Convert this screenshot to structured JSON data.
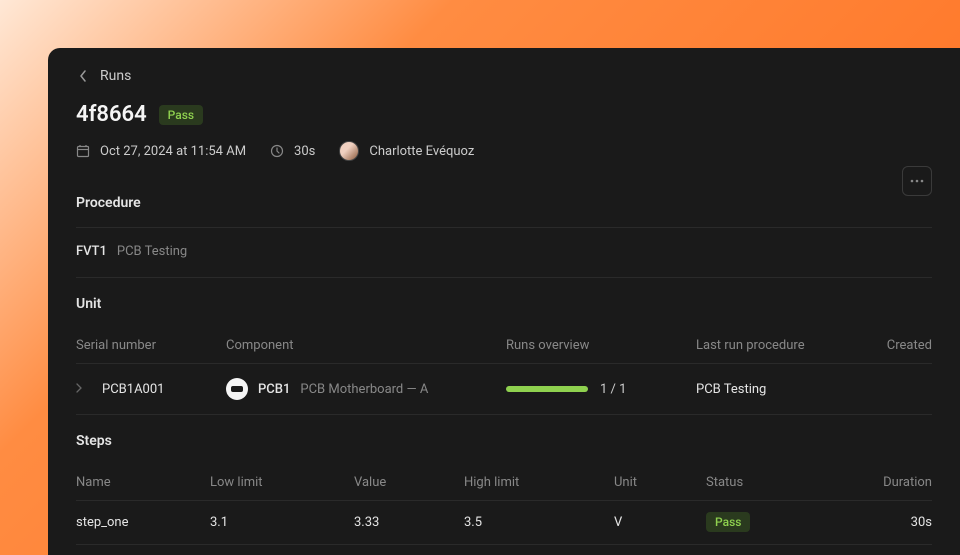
{
  "breadcrumb": {
    "label": "Runs"
  },
  "header": {
    "title": "4f8664",
    "status_badge": "Pass",
    "timestamp": "Oct 27, 2024 at 11:54 AM",
    "duration": "30s",
    "user_name": "Charlotte Evéquoz"
  },
  "procedure": {
    "section_title": "Procedure",
    "code": "FVT1",
    "name": "PCB Testing"
  },
  "unit": {
    "section_title": "Unit",
    "headers": {
      "serial": "Serial number",
      "component": "Component",
      "runs": "Runs overview",
      "last_run": "Last run procedure",
      "created": "Created"
    },
    "rows": [
      {
        "serial": "PCB1A001",
        "component_name": "PCB1",
        "component_desc": "PCB Motherboard — A",
        "runs_fraction": "1 / 1",
        "last_run": "PCB Testing"
      }
    ]
  },
  "steps": {
    "section_title": "Steps",
    "headers": {
      "name": "Name",
      "low": "Low limit",
      "value": "Value",
      "high": "High limit",
      "unit": "Unit",
      "status": "Status",
      "duration": "Duration"
    },
    "rows": [
      {
        "name": "step_one",
        "low": "3.1",
        "value": "3.33",
        "high": "3.5",
        "unit": "V",
        "status": "Pass",
        "duration": "30s"
      }
    ]
  }
}
